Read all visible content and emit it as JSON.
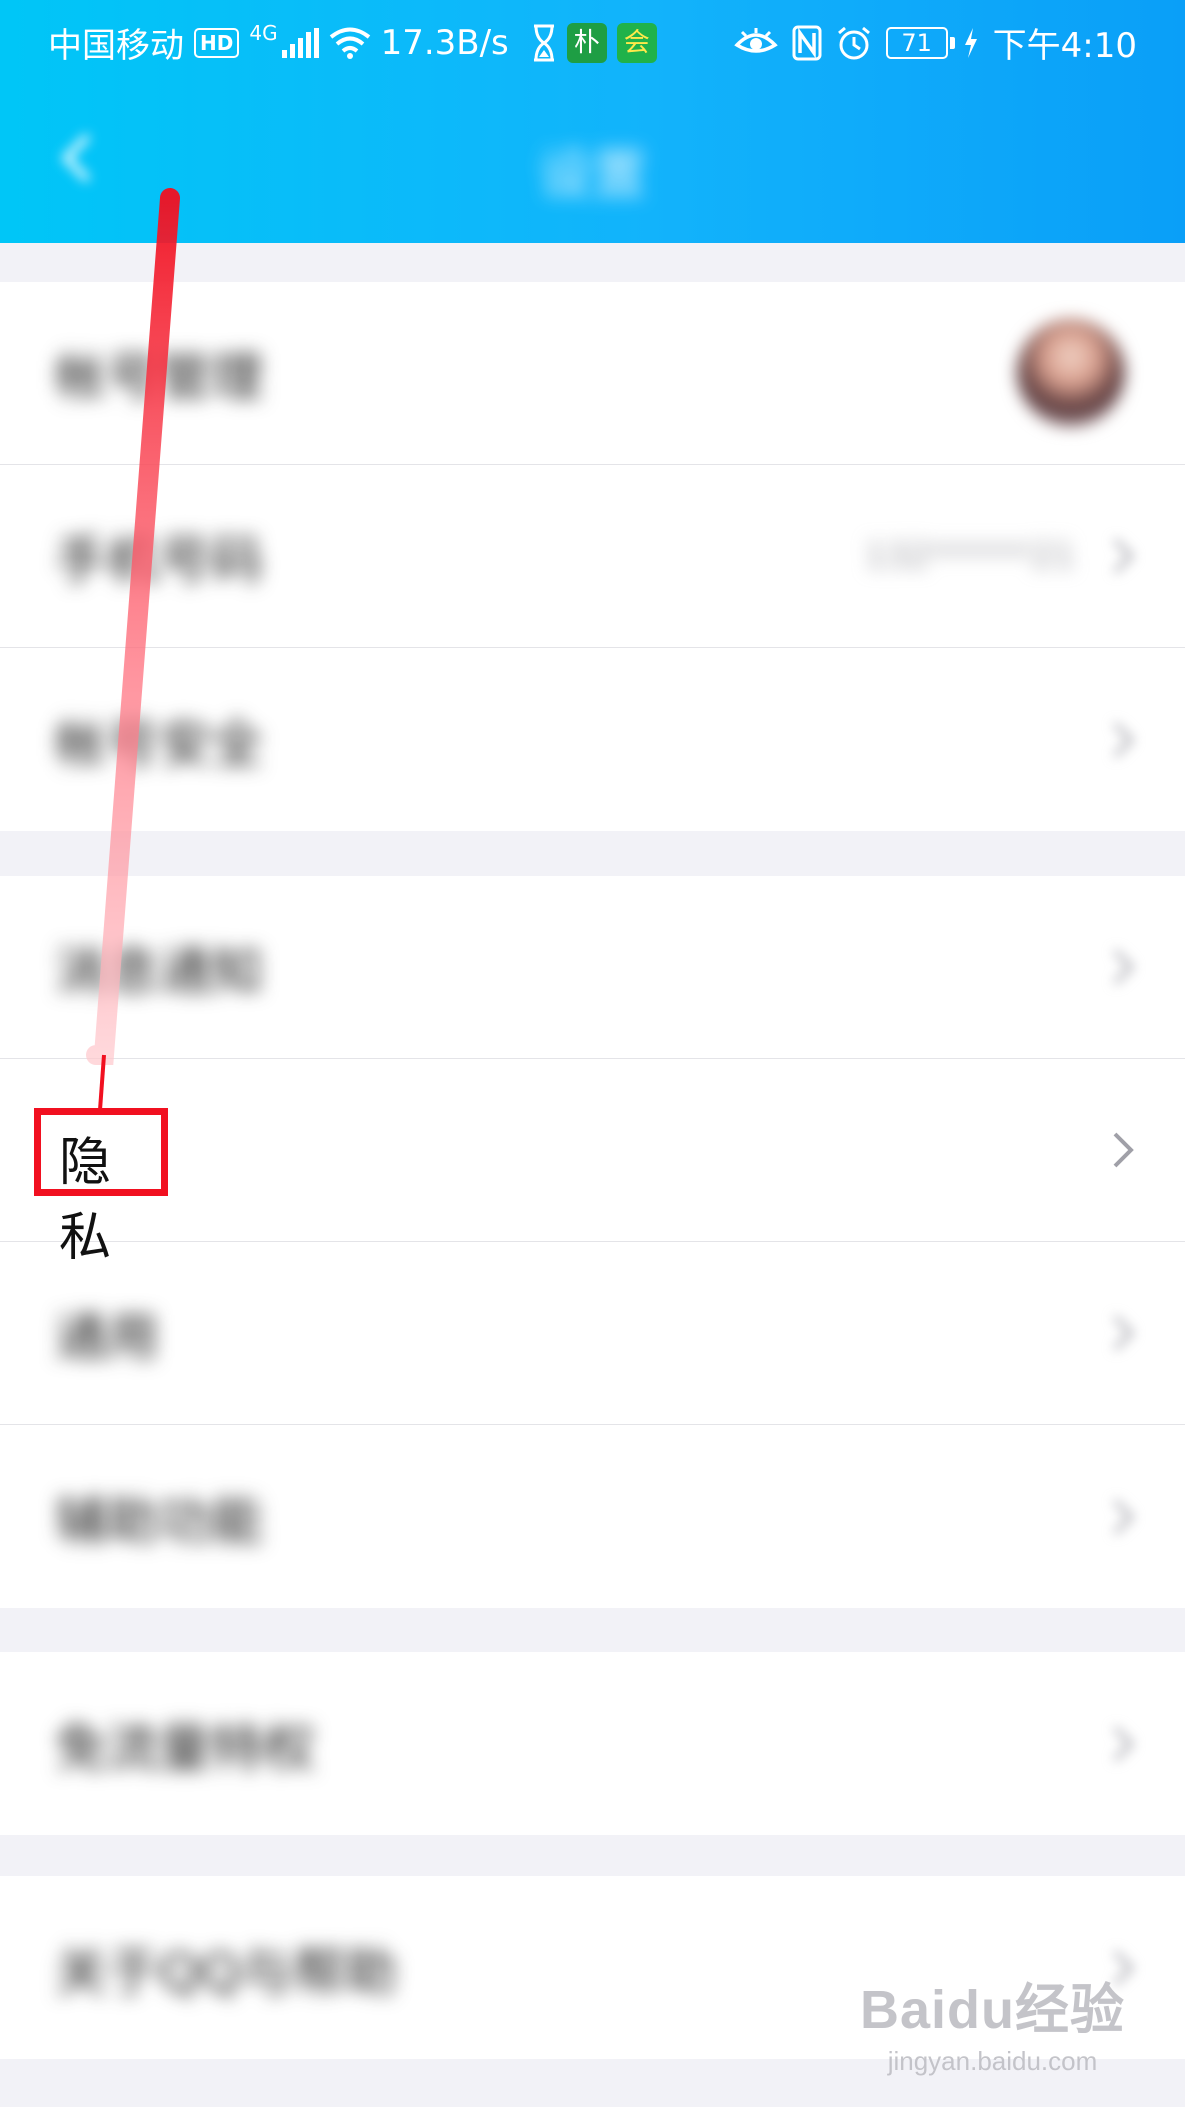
{
  "status_bar": {
    "carrier": "中国移动",
    "hd_badge": "HD",
    "network": "4G",
    "speed": "17.3B/s",
    "app_badge_1": "朴",
    "app_badge_2": "会",
    "battery": "71",
    "time": "下午4:10"
  },
  "header": {
    "title": "设置",
    "back_icon": "chevron-left-icon"
  },
  "settings": {
    "group1": [
      {
        "label": "帐号管理"
      },
      {
        "label": "手机号码",
        "value": "132******21"
      },
      {
        "label": "帐号安全"
      }
    ],
    "group2": [
      {
        "label": "消息通知"
      },
      {
        "label": "隐私"
      },
      {
        "label": "通用"
      },
      {
        "label": "辅助功能"
      }
    ],
    "group3": [
      {
        "label": "免流量特权"
      }
    ],
    "group4": [
      {
        "label": "关于QQ与帮助"
      }
    ]
  },
  "highlight": {
    "label": "隐私",
    "color": "#f11020"
  },
  "watermark": {
    "logo": "Baidu经验",
    "url": "jingyan.baidu.com"
  },
  "colors": {
    "header_start": "#00c6f7",
    "header_end": "#0a9ff8",
    "background": "#f2f2f7",
    "row": "#ffffff",
    "annotation": "#f11020"
  }
}
